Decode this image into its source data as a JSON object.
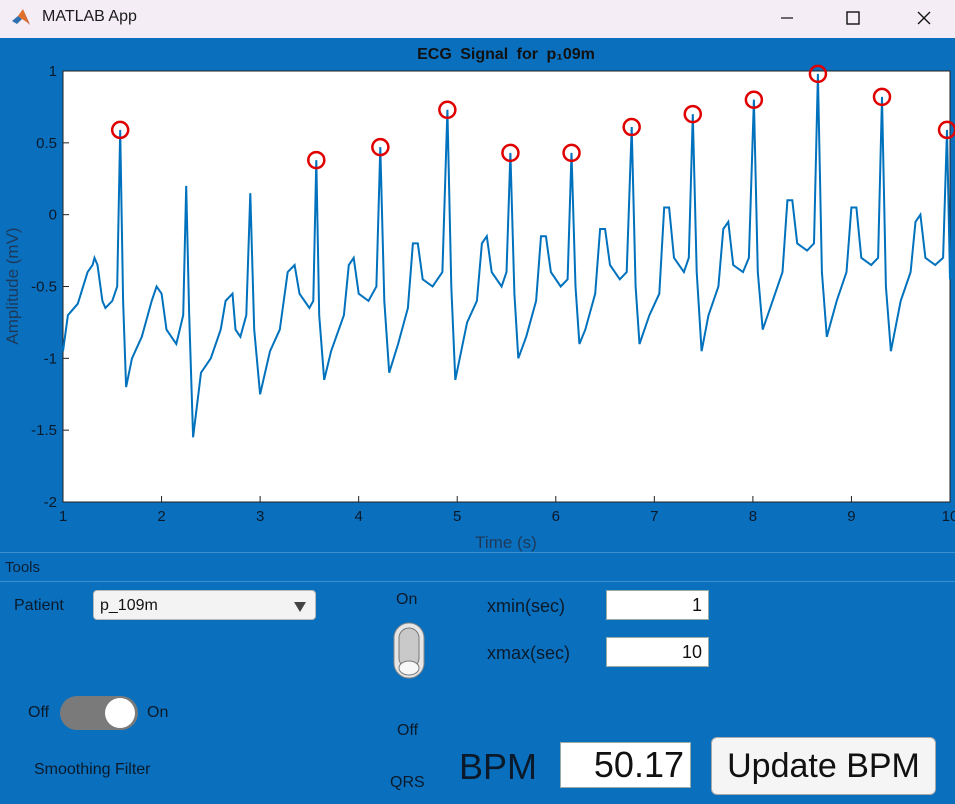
{
  "window": {
    "title": "MATLAB App"
  },
  "chart_data": {
    "type": "line",
    "title": "ECG Signal for p₁09m",
    "xlabel": "Time (s)",
    "ylabel": "Amplitude (mV)",
    "xlim": [
      1,
      10
    ],
    "ylim": [
      -2,
      1
    ],
    "xticks": [
      1,
      2,
      3,
      4,
      5,
      6,
      7,
      8,
      9,
      10
    ],
    "yticks": [
      1,
      0.5,
      0,
      -0.5,
      -1,
      -1.5,
      -2
    ],
    "ytick_labels": [
      "1",
      "0.5",
      "0",
      "-0.5",
      "-1",
      "-1.5",
      "-2"
    ],
    "line_color": "#0072bd",
    "marker_color": "#e00000",
    "peaks": [
      {
        "t": 1.58,
        "v": 0.59
      },
      {
        "t": 3.57,
        "v": 0.38
      },
      {
        "t": 4.22,
        "v": 0.47
      },
      {
        "t": 4.9,
        "v": 0.73
      },
      {
        "t": 5.54,
        "v": 0.43
      },
      {
        "t": 6.16,
        "v": 0.43
      },
      {
        "t": 6.77,
        "v": 0.61
      },
      {
        "t": 7.39,
        "v": 0.7
      },
      {
        "t": 8.01,
        "v": 0.8
      },
      {
        "t": 8.66,
        "v": 0.98
      },
      {
        "t": 9.31,
        "v": 0.82
      },
      {
        "t": 9.97,
        "v": 0.59
      }
    ],
    "signal": [
      [
        1.0,
        -0.95
      ],
      [
        1.05,
        -0.7
      ],
      [
        1.15,
        -0.62
      ],
      [
        1.25,
        -0.4
      ],
      [
        1.3,
        -0.35
      ],
      [
        1.32,
        -0.3
      ],
      [
        1.35,
        -0.35
      ],
      [
        1.4,
        -0.6
      ],
      [
        1.43,
        -0.65
      ],
      [
        1.5,
        -0.6
      ],
      [
        1.55,
        -0.5
      ],
      [
        1.58,
        0.59
      ],
      [
        1.61,
        -0.6
      ],
      [
        1.64,
        -1.2
      ],
      [
        1.7,
        -1.0
      ],
      [
        1.8,
        -0.85
      ],
      [
        1.9,
        -0.6
      ],
      [
        1.95,
        -0.5
      ],
      [
        2.0,
        -0.55
      ],
      [
        2.05,
        -0.8
      ],
      [
        2.1,
        -0.85
      ],
      [
        2.15,
        -0.9
      ],
      [
        2.22,
        -0.7
      ],
      [
        2.25,
        0.2
      ],
      [
        2.28,
        -0.7
      ],
      [
        2.32,
        -1.55
      ],
      [
        2.4,
        -1.1
      ],
      [
        2.5,
        -1.0
      ],
      [
        2.6,
        -0.8
      ],
      [
        2.65,
        -0.6
      ],
      [
        2.72,
        -0.55
      ],
      [
        2.75,
        -0.8
      ],
      [
        2.8,
        -0.85
      ],
      [
        2.86,
        -0.7
      ],
      [
        2.9,
        0.15
      ],
      [
        2.94,
        -0.8
      ],
      [
        3.0,
        -1.25
      ],
      [
        3.1,
        -0.95
      ],
      [
        3.2,
        -0.8
      ],
      [
        3.28,
        -0.4
      ],
      [
        3.35,
        -0.35
      ],
      [
        3.4,
        -0.55
      ],
      [
        3.5,
        -0.65
      ],
      [
        3.54,
        -0.6
      ],
      [
        3.57,
        0.38
      ],
      [
        3.6,
        -0.7
      ],
      [
        3.65,
        -1.15
      ],
      [
        3.72,
        -0.95
      ],
      [
        3.85,
        -0.7
      ],
      [
        3.9,
        -0.35
      ],
      [
        3.95,
        -0.3
      ],
      [
        4.0,
        -0.55
      ],
      [
        4.1,
        -0.6
      ],
      [
        4.18,
        -0.5
      ],
      [
        4.22,
        0.47
      ],
      [
        4.26,
        -0.6
      ],
      [
        4.31,
        -1.1
      ],
      [
        4.4,
        -0.9
      ],
      [
        4.5,
        -0.65
      ],
      [
        4.55,
        -0.2
      ],
      [
        4.6,
        -0.2
      ],
      [
        4.65,
        -0.45
      ],
      [
        4.75,
        -0.5
      ],
      [
        4.85,
        -0.4
      ],
      [
        4.9,
        0.73
      ],
      [
        4.94,
        -0.5
      ],
      [
        4.98,
        -1.15
      ],
      [
        5.1,
        -0.75
      ],
      [
        5.2,
        -0.6
      ],
      [
        5.25,
        -0.2
      ],
      [
        5.3,
        -0.15
      ],
      [
        5.35,
        -0.4
      ],
      [
        5.45,
        -0.5
      ],
      [
        5.5,
        -0.4
      ],
      [
        5.54,
        0.43
      ],
      [
        5.58,
        -0.55
      ],
      [
        5.62,
        -1.0
      ],
      [
        5.7,
        -0.85
      ],
      [
        5.8,
        -0.6
      ],
      [
        5.85,
        -0.15
      ],
      [
        5.9,
        -0.15
      ],
      [
        5.95,
        -0.4
      ],
      [
        6.05,
        -0.5
      ],
      [
        6.12,
        -0.45
      ],
      [
        6.16,
        0.43
      ],
      [
        6.2,
        -0.5
      ],
      [
        6.24,
        -0.9
      ],
      [
        6.3,
        -0.8
      ],
      [
        6.4,
        -0.55
      ],
      [
        6.45,
        -0.1
      ],
      [
        6.5,
        -0.1
      ],
      [
        6.55,
        -0.35
      ],
      [
        6.65,
        -0.45
      ],
      [
        6.72,
        -0.4
      ],
      [
        6.77,
        0.61
      ],
      [
        6.81,
        -0.5
      ],
      [
        6.85,
        -0.9
      ],
      [
        6.95,
        -0.7
      ],
      [
        7.05,
        -0.55
      ],
      [
        7.1,
        0.05
      ],
      [
        7.15,
        0.05
      ],
      [
        7.2,
        -0.3
      ],
      [
        7.3,
        -0.4
      ],
      [
        7.35,
        -0.3
      ],
      [
        7.39,
        0.7
      ],
      [
        7.43,
        -0.4
      ],
      [
        7.48,
        -0.95
      ],
      [
        7.55,
        -0.7
      ],
      [
        7.65,
        -0.5
      ],
      [
        7.7,
        -0.1
      ],
      [
        7.75,
        -0.05
      ],
      [
        7.8,
        -0.35
      ],
      [
        7.9,
        -0.4
      ],
      [
        7.96,
        -0.3
      ],
      [
        8.01,
        0.8
      ],
      [
        8.05,
        -0.4
      ],
      [
        8.1,
        -0.8
      ],
      [
        8.2,
        -0.6
      ],
      [
        8.3,
        -0.4
      ],
      [
        8.35,
        0.1
      ],
      [
        8.4,
        0.1
      ],
      [
        8.45,
        -0.2
      ],
      [
        8.55,
        -0.25
      ],
      [
        8.62,
        -0.2
      ],
      [
        8.66,
        0.98
      ],
      [
        8.7,
        -0.4
      ],
      [
        8.75,
        -0.85
      ],
      [
        8.85,
        -0.6
      ],
      [
        8.95,
        -0.4
      ],
      [
        9.0,
        0.05
      ],
      [
        9.05,
        0.05
      ],
      [
        9.1,
        -0.3
      ],
      [
        9.2,
        -0.35
      ],
      [
        9.27,
        -0.3
      ],
      [
        9.31,
        0.82
      ],
      [
        9.35,
        -0.5
      ],
      [
        9.4,
        -0.95
      ],
      [
        9.5,
        -0.6
      ],
      [
        9.6,
        -0.4
      ],
      [
        9.65,
        -0.05
      ],
      [
        9.7,
        0.0
      ],
      [
        9.75,
        -0.3
      ],
      [
        9.85,
        -0.35
      ],
      [
        9.93,
        -0.3
      ],
      [
        9.97,
        0.59
      ],
      [
        10.0,
        -0.45
      ]
    ]
  },
  "tools": {
    "label": "Tools",
    "patient_label": "Patient",
    "patient_value": "p_109m",
    "qrs_switch": {
      "on_label": "On",
      "off_label": "Off",
      "name_label": "QRS"
    },
    "smoothing": {
      "off_label": "Off",
      "on_label": "On",
      "name_label": "Smoothing Filter"
    },
    "xmin_label": "xmin(sec)",
    "xmin_value": "1",
    "xmax_label": "xmax(sec)",
    "xmax_value": "10",
    "bpm_label": "BPM",
    "bpm_value": "50.17",
    "update_label": "Update BPM"
  }
}
